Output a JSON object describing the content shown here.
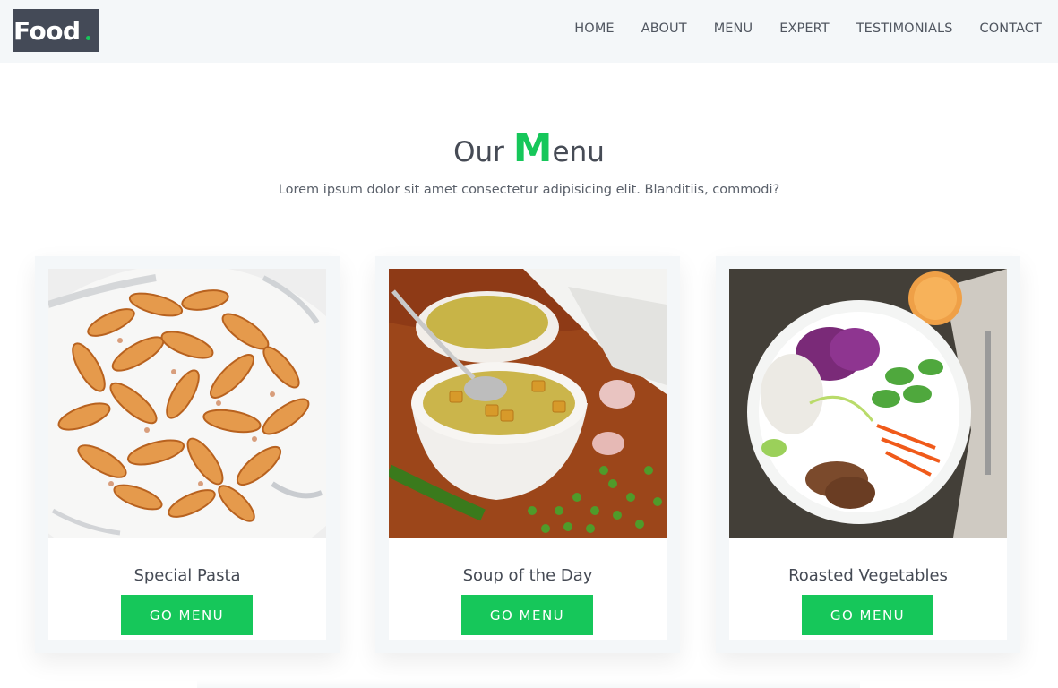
{
  "header": {
    "logo": "Food",
    "nav": [
      "HOME",
      "ABOUT",
      "MENU",
      "EXPERT",
      "TESTIMONIALS",
      "CONTACT"
    ]
  },
  "section": {
    "title_start": "Our ",
    "title_highlight": "M",
    "title_end": "enu",
    "subtitle": "Lorem ipsum dolor sit amet consectetur adipisicing elit. Blanditiis, commodi?"
  },
  "cards": [
    {
      "title": "Special Pasta",
      "button": "GO MENU",
      "image": "pasta-photo"
    },
    {
      "title": "Soup of the Day",
      "button": "GO MENU",
      "image": "soup-photo"
    },
    {
      "title": "Roasted Vegetables",
      "button": "GO MENU",
      "image": "salad-bowl-photo"
    }
  ],
  "colors": {
    "accent": "#16c75a",
    "logo_bg": "#444a57",
    "header_bg": "#f4f7f9",
    "text": "#464b55"
  }
}
